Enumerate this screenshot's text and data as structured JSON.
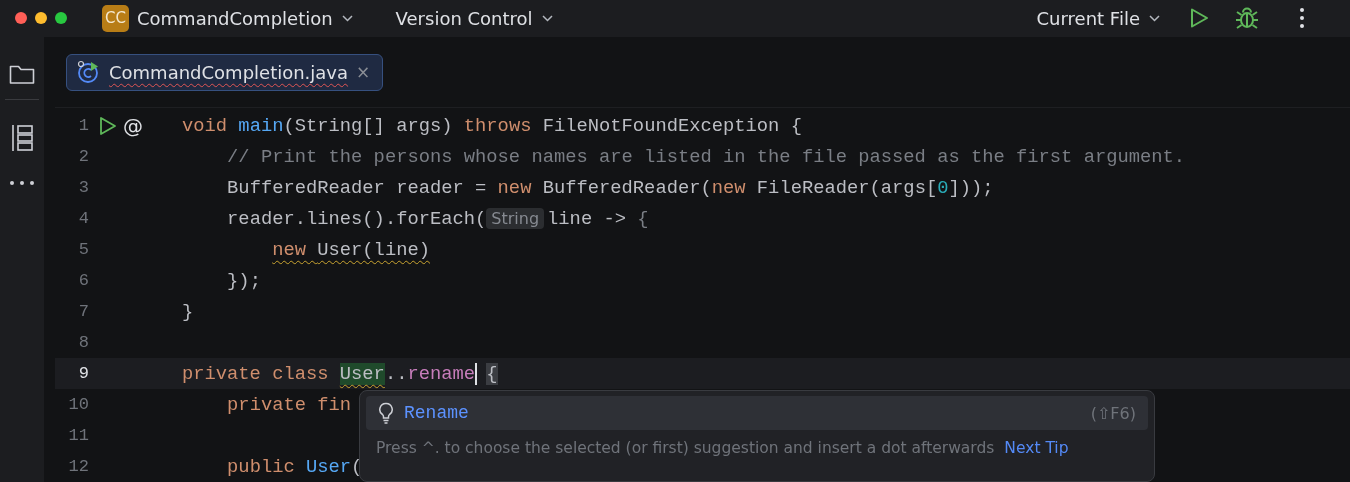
{
  "title_bar": {
    "project_badge": "CC",
    "project": "CommandCompletion",
    "vcs": "Version Control",
    "run_config": "Current File"
  },
  "tool_strip": {
    "items": [
      {
        "kind": "folder"
      },
      {
        "kind": "structure"
      },
      {
        "kind": "more"
      }
    ]
  },
  "tabs": [
    {
      "label": "CommandCompletion.java",
      "selected": true,
      "has_error": true,
      "close": "×"
    }
  ],
  "editor": {
    "lines": [
      {
        "number": "1",
        "current": false,
        "runnable": true,
        "mark": "@",
        "tokens": [
          {
            "text": "void ",
            "kind": "keyword"
          },
          {
            "text": "main",
            "kind": "method"
          },
          {
            "text": "(String[] args) ",
            "kind": "plain"
          },
          {
            "text": "throws ",
            "kind": "keyword"
          },
          {
            "text": "FileNotFoundException {",
            "kind": "plain"
          }
        ]
      },
      {
        "number": "2",
        "current": false,
        "runnable": false,
        "tokens": [
          {
            "text": "    // Print the persons whose names are listed in the file passed as the first argument.",
            "kind": "comment"
          }
        ]
      },
      {
        "number": "3",
        "current": false,
        "runnable": false,
        "tokens": [
          {
            "text": "    BufferedReader reader = ",
            "kind": "plain"
          },
          {
            "text": "new ",
            "kind": "keyword"
          },
          {
            "text": "BufferedReader(",
            "kind": "plain"
          },
          {
            "text": "new ",
            "kind": "keyword"
          },
          {
            "text": "FileReader(args[",
            "kind": "plain"
          },
          {
            "text": "0",
            "kind": "number"
          },
          {
            "text": "]));",
            "kind": "plain"
          }
        ]
      },
      {
        "number": "4",
        "current": false,
        "runnable": false,
        "tokens": [
          {
            "text": "    reader.lines().forEach(",
            "kind": "plain"
          },
          {
            "text": "String",
            "kind": "inlay"
          },
          {
            "text": "line -> ",
            "kind": "plain"
          },
          {
            "text": "{",
            "kind": "dim"
          }
        ]
      },
      {
        "number": "5",
        "current": false,
        "runnable": false,
        "tokens": [
          {
            "text": "        new ",
            "kind": "keyword",
            "warned": true
          },
          {
            "text": "User(line)",
            "kind": "plain",
            "warned": true
          }
        ]
      },
      {
        "number": "6",
        "current": false,
        "runnable": false,
        "tokens": [
          {
            "text": "    });",
            "kind": "plain"
          }
        ]
      },
      {
        "number": "7",
        "current": false,
        "runnable": false,
        "tokens": [
          {
            "text": "}",
            "kind": "plain"
          }
        ]
      },
      {
        "number": "8",
        "current": false,
        "runnable": false
      },
      {
        "number": "9",
        "current": true,
        "runnable": false,
        "caret": true,
        "tokens": [
          {
            "text": "private class ",
            "kind": "keyword"
          },
          {
            "text": "User",
            "kind": "usage",
            "warned": true
          },
          {
            "text": "..",
            "kind": "plain"
          },
          {
            "text": "rename",
            "kind": "member"
          },
          {
            "text": "{",
            "kind": "brace"
          }
        ]
      },
      {
        "number": "10",
        "current": false,
        "runnable": false,
        "tokens": [
          {
            "text": "    private fin",
            "kind": "keyword"
          }
        ]
      },
      {
        "number": "11",
        "current": false,
        "runnable": false
      },
      {
        "number": "12",
        "current": false,
        "runnable": false,
        "tokens": [
          {
            "text": "    public ",
            "kind": "keyword"
          },
          {
            "text": "User",
            "kind": "method"
          },
          {
            "text": "(",
            "kind": "plain"
          }
        ]
      }
    ]
  },
  "completion_popup": {
    "items": [
      {
        "label": "Rename",
        "shortcut": "(⇧F6)",
        "selected": true
      }
    ],
    "hint": "Press ^. to choose the selected (or first) suggestion and insert a dot afterwards",
    "hint_link": "Next Tip"
  }
}
